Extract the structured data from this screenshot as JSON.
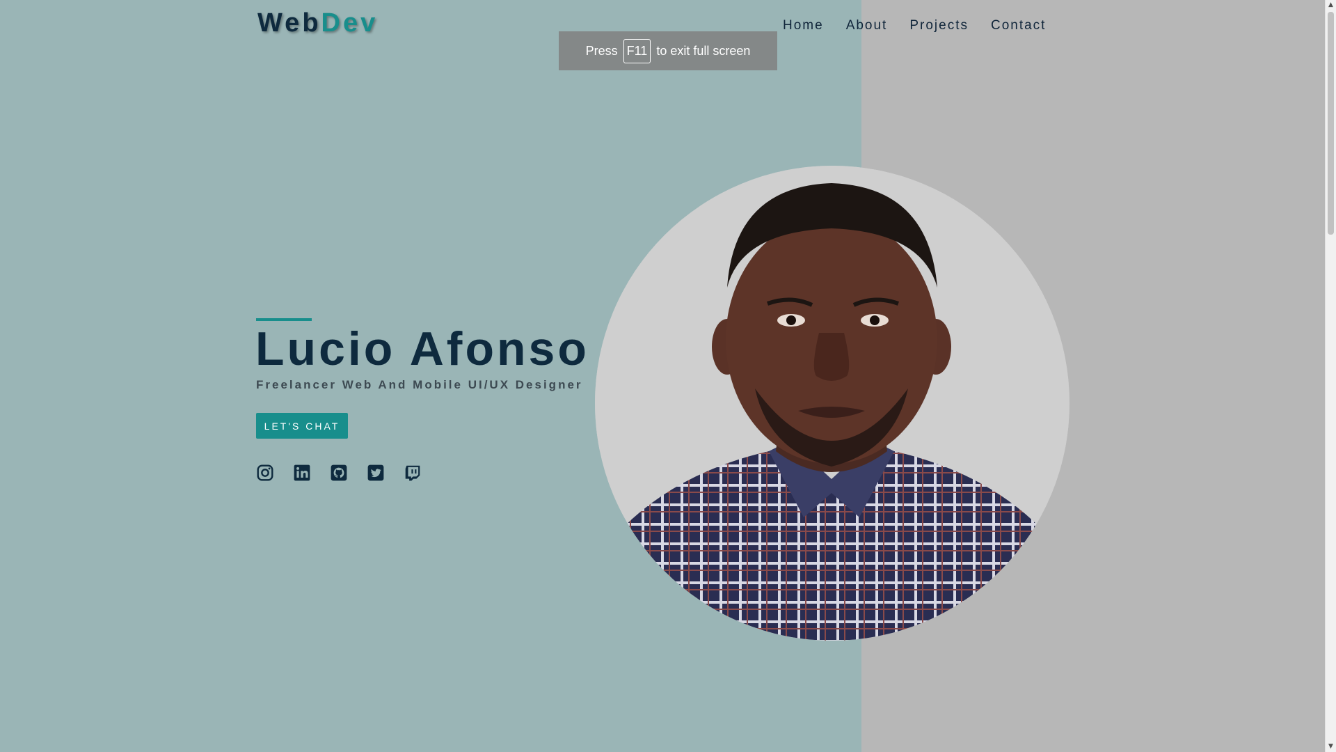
{
  "brand": {
    "part1": "Web",
    "part2": "Dev"
  },
  "nav": [
    {
      "label": "Home"
    },
    {
      "label": "About"
    },
    {
      "label": "Projects"
    },
    {
      "label": "Contact"
    }
  ],
  "fullscreen_notice": {
    "before": "Press",
    "key": "F11",
    "after": "to exit full screen"
  },
  "hero": {
    "name": "Lucio Afonso",
    "tagline": "Freelancer Web And Mobile UI/UX Designer",
    "cta_label": "LET'S CHAT"
  },
  "socials": [
    {
      "icon": "instagram-icon"
    },
    {
      "icon": "linkedin-icon"
    },
    {
      "icon": "github-icon"
    },
    {
      "icon": "twitter-icon"
    },
    {
      "icon": "twitch-icon"
    }
  ],
  "colors": {
    "left_background": "#9ab5b6",
    "right_background": "#b7b7b7",
    "accent": "#188e8c",
    "text_dark": "#0e2a3e"
  }
}
